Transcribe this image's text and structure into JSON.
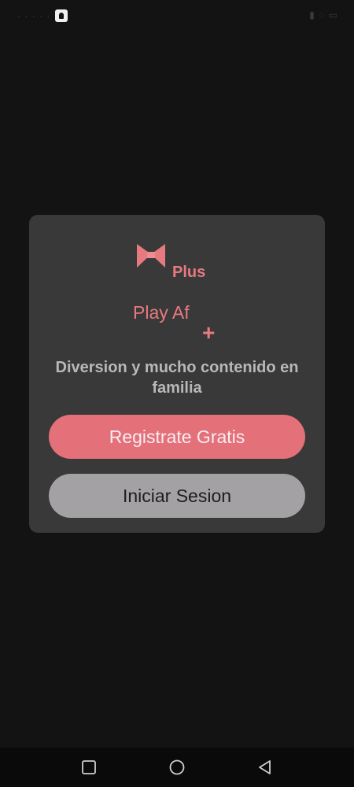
{
  "status_bar": {
    "left_text": "· · · · ·",
    "right_text": "▮ ◌ ▭"
  },
  "logo": {
    "icon": "bowtie-logo-icon",
    "plus_text": "Plus",
    "color": "#e77a7f"
  },
  "brand": {
    "name": "Play Af",
    "plus_symbol": "+"
  },
  "tagline": "Diversion y mucho contenido en familia",
  "buttons": {
    "register": "Registrate Gratis",
    "login": "Iniciar Sesion"
  },
  "colors": {
    "background": "#141314",
    "card": "#3a393a",
    "accent": "#e4707a",
    "secondary_button": "#a3a1a4"
  },
  "nav_bar": {
    "icons": [
      "square-recent-apps-icon",
      "circle-home-icon",
      "triangle-back-icon"
    ]
  }
}
